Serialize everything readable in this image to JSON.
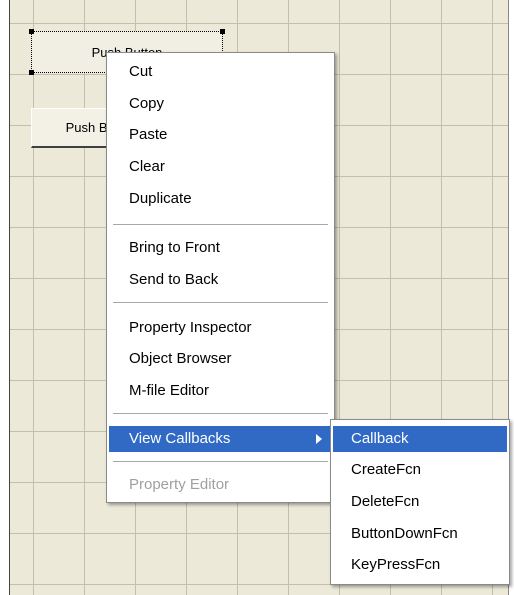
{
  "canvas": {
    "buttons": [
      {
        "label": "Push Button"
      },
      {
        "label": "Push Button"
      }
    ]
  },
  "context_menu": {
    "items": [
      {
        "label": "Cut"
      },
      {
        "label": "Copy"
      },
      {
        "label": "Paste"
      },
      {
        "label": "Clear"
      },
      {
        "label": "Duplicate"
      },
      {
        "label": "Bring to Front"
      },
      {
        "label": "Send to Back"
      },
      {
        "label": "Property Inspector"
      },
      {
        "label": "Object Browser"
      },
      {
        "label": "M-file Editor"
      },
      {
        "label": "View Callbacks",
        "highlighted": true,
        "has_submenu": true
      },
      {
        "label": "Property Editor",
        "disabled": true
      }
    ]
  },
  "submenu": {
    "items": [
      {
        "label": "Callback",
        "highlighted": true
      },
      {
        "label": "CreateFcn"
      },
      {
        "label": "DeleteFcn"
      },
      {
        "label": "ButtonDownFcn"
      },
      {
        "label": "KeyPressFcn"
      }
    ]
  },
  "colors": {
    "highlight": "#316ac5",
    "canvas_background": "#ece9d8",
    "disabled_text": "#a0a0a0"
  }
}
